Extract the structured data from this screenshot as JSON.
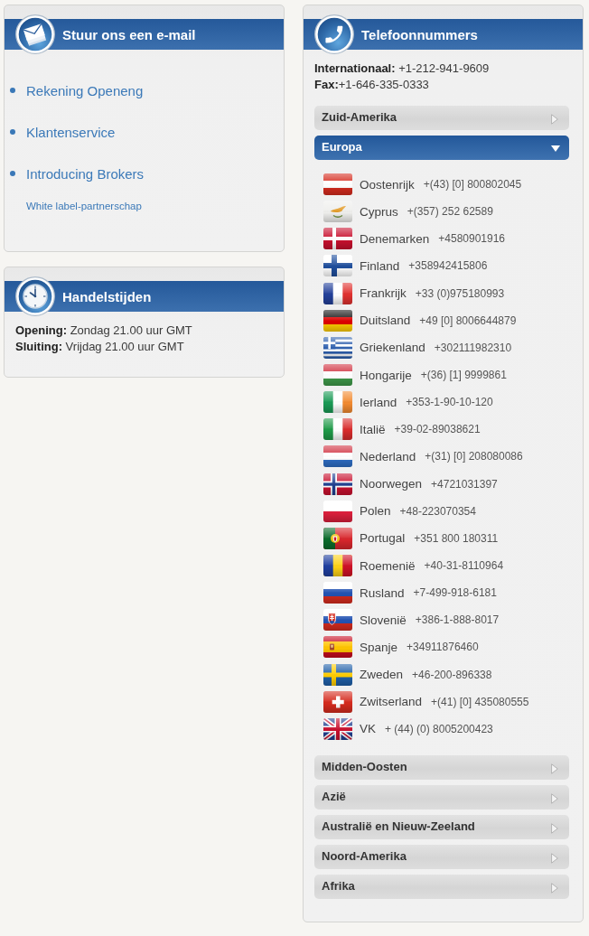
{
  "email_panel": {
    "title": "Stuur ons een e-mail",
    "links": [
      {
        "kind": "main",
        "label": "Rekening Openeng"
      },
      {
        "kind": "main",
        "label": "Klantenservice"
      },
      {
        "kind": "main",
        "label": "Introducing Brokers"
      },
      {
        "kind": "sub",
        "label": "White label-partnerschap"
      }
    ]
  },
  "hours_panel": {
    "title": "Handelstijden",
    "lines": [
      "**Opening:** Zondag 21.00 uur GMT",
      "**Sluiting:** Vrijdag 21.00 uur GMT"
    ]
  },
  "phone_panel": {
    "title": "Telefoonnummers",
    "lines": [
      "**Internationaal:** +1-212-941-9609",
      "**Fax:**+1-646-335-0333"
    ],
    "regions": [
      {
        "label": "Zuid-Amerika",
        "expanded": false
      },
      {
        "label": "Europa",
        "expanded": true,
        "countries": [
          {
            "kind": "austria",
            "name": "Oostenrijk",
            "phone": "+(43) [0] 800802045"
          },
          {
            "kind": "cyprus",
            "name": "Cyprus",
            "phone": "+(357) 252 62589"
          },
          {
            "kind": "denmark",
            "name": "Denemarken",
            "phone": "+4580901916"
          },
          {
            "kind": "finland",
            "name": "Finland",
            "phone": "+358942415806"
          },
          {
            "kind": "france",
            "name": "Frankrijk",
            "phone": "+33 (0)975180993"
          },
          {
            "kind": "germany",
            "name": "Duitsland",
            "phone": "+49 [0] 8006644879"
          },
          {
            "kind": "greece",
            "name": "Griekenland",
            "phone": "+302111982310"
          },
          {
            "kind": "hungary",
            "name": "Hongarije",
            "phone": "+(36) [1] 9999861"
          },
          {
            "kind": "ireland",
            "name": "Ierland",
            "phone": "+353-1-90-10-120"
          },
          {
            "kind": "italy",
            "name": "Italië",
            "phone": "+39-02-89038621"
          },
          {
            "kind": "netherlands",
            "name": "Nederland",
            "phone": "+(31) [0] 208080086"
          },
          {
            "kind": "norway",
            "name": "Noorwegen",
            "phone": "+4721031397"
          },
          {
            "kind": "poland",
            "name": "Polen",
            "phone": "+48-223070354"
          },
          {
            "kind": "portugal",
            "name": "Portugal",
            "phone": "+351 800 180311"
          },
          {
            "kind": "romania",
            "name": "Roemenië",
            "phone": "+40-31-8110964"
          },
          {
            "kind": "russia",
            "name": "Rusland",
            "phone": "+7-499-918-6181"
          },
          {
            "kind": "slovakia",
            "name": "Slovenië",
            "phone": "+386-1-888-8017"
          },
          {
            "kind": "spain",
            "name": "Spanje",
            "phone": "+34911876460"
          },
          {
            "kind": "sweden",
            "name": "Zweden",
            "phone": "+46-200-896338"
          },
          {
            "kind": "switzerland",
            "name": "Zwitserland",
            "phone": "+(41) [0] 435080555"
          },
          {
            "kind": "uk",
            "name": "VK",
            "phone": "+ (44) (0) 8005200423"
          }
        ]
      },
      {
        "label": "Midden-Oosten",
        "expanded": false
      },
      {
        "label": "Azië",
        "expanded": false
      },
      {
        "label": "Australië en Nieuw-Zeeland",
        "expanded": false
      },
      {
        "label": "Noord-Amerika",
        "expanded": false
      },
      {
        "label": "Afrika",
        "expanded": false
      }
    ]
  }
}
